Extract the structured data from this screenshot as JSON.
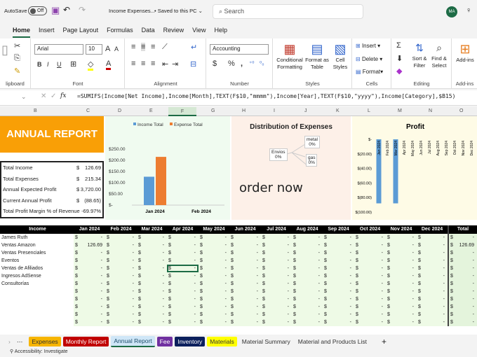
{
  "titlebar": {
    "autosave": "AutoSave",
    "toggle": "Off",
    "doc_title": "Income Expenses...",
    "saved": "• Saved to this PC ⌄",
    "search_placeholder": "Search",
    "avatar": "MA"
  },
  "menu": [
    "Home",
    "Insert",
    "Page Layout",
    "Formulas",
    "Data",
    "Review",
    "View",
    "Help"
  ],
  "ribbon": {
    "font": "Arial",
    "size": "10",
    "number_format": "Accounting",
    "groups": [
      "lipboard",
      "Font",
      "Alignment",
      "Number",
      "Styles",
      "Cells",
      "Editing",
      "Add-ins"
    ],
    "conditional": "Conditional Formatting",
    "format_table": "Format as Table",
    "cell_styles": "Cell Styles",
    "insert": "Insert",
    "delete": "Delete",
    "format": "Format",
    "sort": "Sort & Filter",
    "find": "Find & Select",
    "addins": "Add-ins"
  },
  "formula": "=SUMIFS(Income[Net Income],Income[Month],TEXT(F$10,\"mmmm\"),Income[Year],TEXT(F$10,\"yyyy\"),Income[Category],$B15)",
  "columns": [
    "B",
    "C",
    "D",
    "E",
    "F",
    "G",
    "H",
    "I",
    "J",
    "K",
    "L",
    "M",
    "N",
    "O"
  ],
  "report": {
    "title": "ANNUAL REPORT",
    "rows": [
      {
        "label": "Total Income",
        "cur": "$",
        "value": "126.69"
      },
      {
        "label": "Total Expenses",
        "cur": "$",
        "value": "215.34"
      },
      {
        "label": "Annual Expected Profit",
        "cur": "$",
        "value": "3,720.00"
      },
      {
        "label": "Current Annual Profit",
        "cur": "$",
        "value": "(88.65)"
      },
      {
        "label": "Total Profit Margin % of Revenue",
        "cur": "",
        "value": "-69.97%"
      }
    ]
  },
  "chart_data": [
    {
      "type": "bar",
      "title": "",
      "categories": [
        "Jan 2024",
        "Feb 2024"
      ],
      "series": [
        {
          "name": "Income Total",
          "color": "#5b9bd5",
          "values": [
            126.69,
            0
          ]
        },
        {
          "name": "Expense Total",
          "color": "#ed7d31",
          "values": [
            215.34,
            0
          ]
        }
      ],
      "yticks": [
        "$250.00",
        "$200.00",
        "$150.00",
        "$100.00",
        "$50.00",
        "$-"
      ],
      "ylim": [
        0,
        250
      ],
      "legend": "top"
    },
    {
      "type": "pie",
      "title": "Distribution of Expenses",
      "labels": [
        {
          "name": "Envios",
          "pct": "0%"
        },
        {
          "name": "metal",
          "pct": "0%"
        },
        {
          "name": "gas",
          "pct": "0%"
        }
      ]
    },
    {
      "type": "bar",
      "title": "Profit",
      "categories": [
        "Jan 2024",
        "Feb 2024",
        "Mar 2024",
        "Apr 2024",
        "May 2024",
        "Jun 2024",
        "Jul 2024",
        "Aug 2024",
        "Sep 2024",
        "Oct 2024",
        "Nov 2024",
        "Dec 2024"
      ],
      "values": [
        -88,
        0,
        -88,
        0,
        0,
        0,
        0,
        0,
        0,
        0,
        0,
        0
      ],
      "yticks": [
        "$-",
        "$(20.00)",
        "$(40.00)",
        "$(60.00)",
        "$(80.00)",
        "$(100.00)"
      ],
      "ylim": [
        -100,
        0
      ],
      "color": "#5b9bd5"
    }
  ],
  "overlay_text": "order now",
  "table": {
    "headers": [
      "Income",
      "Jan 2024",
      "Feb 2024",
      "Mar 2024",
      "Apr 2024",
      "May 2024",
      "Jun 2024",
      "Jul 2024",
      "Aug 2024",
      "Sep 2024",
      "Oct 2024",
      "Nov 2024",
      "Dec 2024",
      "Total"
    ],
    "rows": [
      {
        "label": "James Ruth",
        "values": [
          "-",
          "-",
          "-",
          "-",
          "-",
          "-",
          "-",
          "-",
          "-",
          "-",
          "-",
          "-",
          "-"
        ]
      },
      {
        "label": "Ventas Amazon",
        "values": [
          "126.69",
          "-",
          "-",
          "-",
          "-",
          "-",
          "-",
          "-",
          "-",
          "-",
          "-",
          "-",
          "126.69"
        ]
      },
      {
        "label": "Ventas Presenciales",
        "values": [
          "-",
          "-",
          "-",
          "-",
          "-",
          "-",
          "-",
          "-",
          "-",
          "-",
          "-",
          "-",
          "-"
        ]
      },
      {
        "label": "Eventos",
        "values": [
          "-",
          "-",
          "-",
          "-",
          "-",
          "-",
          "-",
          "-",
          "-",
          "-",
          "-",
          "-",
          "-"
        ]
      },
      {
        "label": "Ventas de Afiliados",
        "values": [
          "-",
          "-",
          "-",
          "-",
          "-",
          "-",
          "-",
          "-",
          "-",
          "-",
          "-",
          "-",
          "-"
        ]
      },
      {
        "label": "Ingresos AdSense",
        "values": [
          "-",
          "-",
          "-",
          "-",
          "-",
          "-",
          "-",
          "-",
          "-",
          "-",
          "-",
          "-",
          "-"
        ]
      },
      {
        "label": "Consultorías",
        "values": [
          "-",
          "-",
          "-",
          "-",
          "-",
          "-",
          "-",
          "-",
          "-",
          "-",
          "-",
          "-",
          "-"
        ]
      },
      {
        "label": "",
        "values": [
          "-",
          "-",
          "-",
          "-",
          "-",
          "-",
          "-",
          "-",
          "-",
          "-",
          "-",
          "-",
          "-"
        ]
      },
      {
        "label": "",
        "values": [
          "-",
          "-",
          "-",
          "-",
          "-",
          "-",
          "-",
          "-",
          "-",
          "-",
          "-",
          "-",
          "-"
        ]
      },
      {
        "label": "",
        "values": [
          "-",
          "-",
          "-",
          "-",
          "-",
          "-",
          "-",
          "-",
          "-",
          "-",
          "-",
          "-",
          "-"
        ]
      },
      {
        "label": "",
        "values": [
          "-",
          "-",
          "-",
          "-",
          "-",
          "-",
          "-",
          "-",
          "-",
          "-",
          "-",
          "-",
          "-"
        ]
      },
      {
        "label": "",
        "values": [
          "-",
          "-",
          "-",
          "-",
          "-",
          "-",
          "-",
          "-",
          "-",
          "-",
          "-",
          "-",
          "-"
        ]
      }
    ]
  },
  "sheet_tabs": [
    {
      "label": "Expenses",
      "bg": "#f7b500",
      "fg": "#333"
    },
    {
      "label": "Monthly Report",
      "bg": "#c00000",
      "fg": "#fff"
    },
    {
      "label": "Annual Report",
      "bg": "#cfe6f7",
      "fg": "#1d4e6b",
      "active": true
    },
    {
      "label": "Fee",
      "bg": "#7030a0",
      "fg": "#fff"
    },
    {
      "label": "Inventory",
      "bg": "#0b1f5c",
      "fg": "#fff"
    },
    {
      "label": "Materials",
      "bg": "#ffff00",
      "fg": "#333"
    },
    {
      "label": "Material Summary",
      "bg": "transparent",
      "fg": "#333"
    },
    {
      "label": "Material and Products List",
      "bg": "transparent",
      "fg": "#333"
    }
  ],
  "status": "Accessibility: Investigate"
}
